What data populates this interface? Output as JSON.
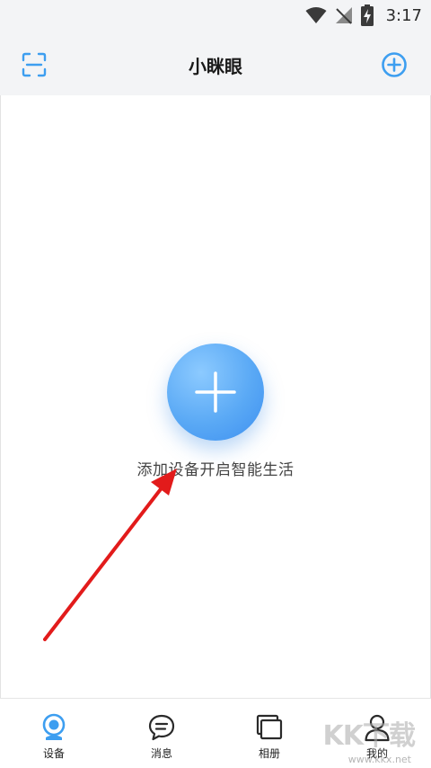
{
  "status_bar": {
    "time": "3:17"
  },
  "app_bar": {
    "title": "小眯眼"
  },
  "empty_state": {
    "hint": "添加设备开启智能生活"
  },
  "nav": {
    "items": [
      {
        "label": "设备",
        "icon": "camera-icon",
        "active": true
      },
      {
        "label": "消息",
        "icon": "message-icon",
        "active": false
      },
      {
        "label": "相册",
        "icon": "album-icon",
        "active": false
      },
      {
        "label": "我的",
        "icon": "user-icon",
        "active": false
      }
    ]
  },
  "watermark": {
    "brand": "KK下载",
    "url": "www.kkx.net"
  },
  "colors": {
    "accent": "#3d9ef0",
    "fab": "#5aa9f5",
    "arrow": "#e21b1b",
    "bar_bg": "#f3f4f6"
  }
}
